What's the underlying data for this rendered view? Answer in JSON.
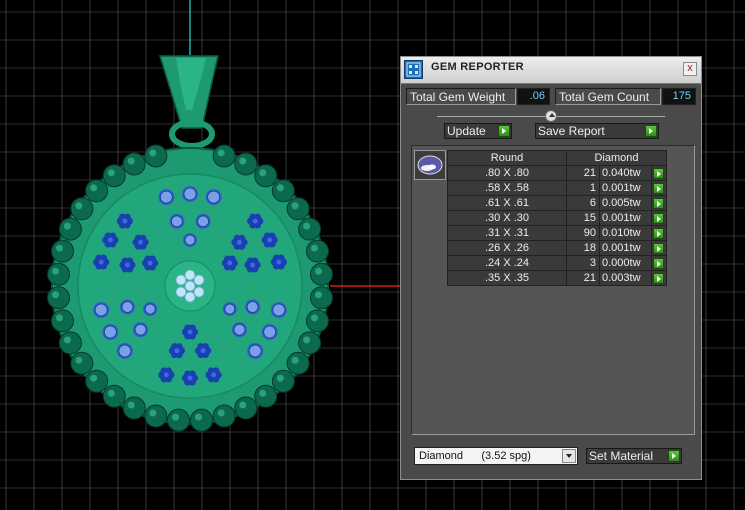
{
  "panel": {
    "title": "GEM REPORTER",
    "close": "x",
    "total_gem_weight_label": "Total Gem Weight",
    "total_gem_weight": ".06",
    "total_gem_count_label": "Total Gem Count",
    "total_gem_count": "175",
    "update_label": "Update",
    "save_report_label": "Save Report",
    "table": {
      "col_shape": "Round",
      "col_material": "Diamond",
      "rows": [
        {
          "size": ".80 X .80",
          "count": "21",
          "weight": "0.040tw"
        },
        {
          "size": ".58 X .58",
          "count": "1",
          "weight": "0.001tw"
        },
        {
          "size": ".61 X .61",
          "count": "6",
          "weight": "0.005tw"
        },
        {
          "size": ".30 X .30",
          "count": "15",
          "weight": "0.001tw"
        },
        {
          "size": ".31 X .31",
          "count": "90",
          "weight": "0.010tw"
        },
        {
          "size": ".26 X .26",
          "count": "18",
          "weight": "0.001tw"
        },
        {
          "size": ".24 X .24",
          "count": "3",
          "weight": "0.000tw"
        },
        {
          "size": ".35 X .35",
          "count": "21",
          "weight": "0.003tw"
        }
      ]
    },
    "material_select": "Diamond      (3.52 spg)",
    "set_material_label": "Set Material"
  },
  "colors": {
    "viewport_bg": "#000000",
    "grid": "#5a5a5a",
    "metal": "#1d9a72",
    "metal_light": "#3fc59a",
    "bead": "#0b6a4e",
    "gem_blue": "#1a3fb0",
    "gem_light": "#7aa0e8",
    "center_gem": "#bfe6f6",
    "accent_green": "#3aa81f",
    "value_text": "#6fd0ff"
  },
  "icons": {
    "app": "gem-reporter-icon",
    "close": "close-icon",
    "go": "green-arrow-icon",
    "gem": "round-gem-icon",
    "dropdown": "chevron-down-icon"
  }
}
